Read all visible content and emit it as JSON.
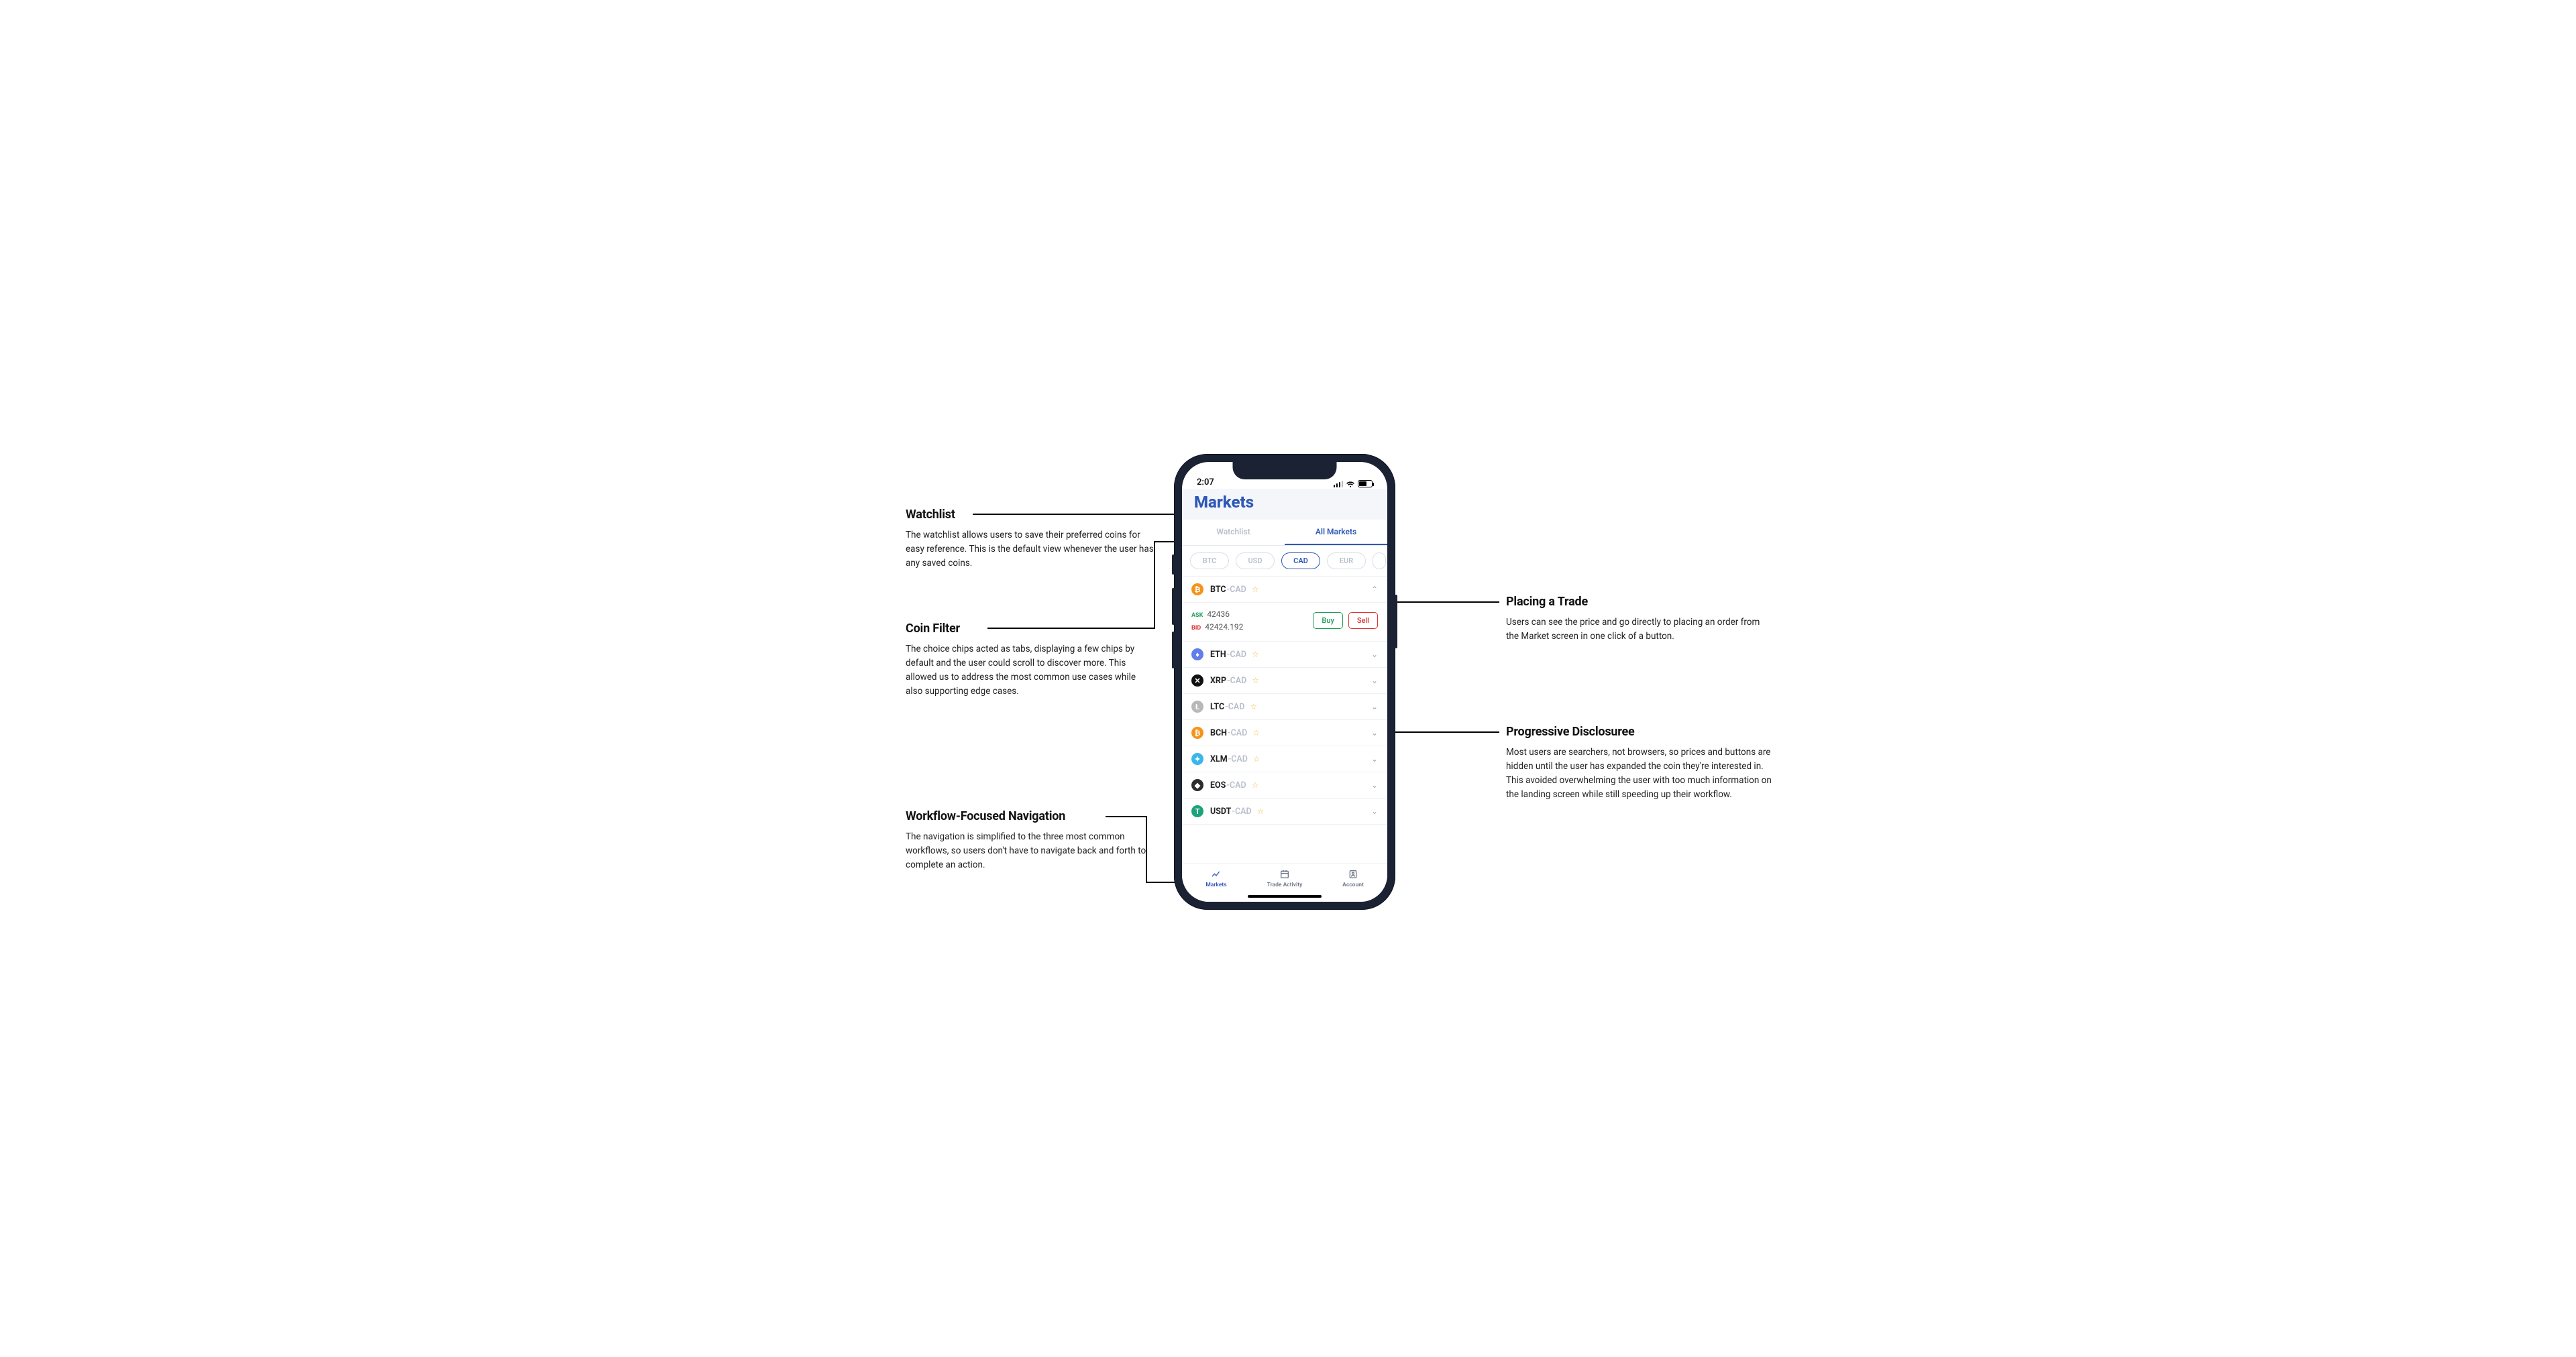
{
  "status": {
    "time": "2:07"
  },
  "app": {
    "title": "Markets"
  },
  "tabs": {
    "watchlist": "Watchlist",
    "all_markets": "All Markets"
  },
  "chips": [
    "BTC",
    "USD",
    "CAD",
    "EUR"
  ],
  "expanded": {
    "ask_label": "ASK",
    "bid_label": "BID",
    "ask_value": "42436",
    "bid_value": "42424.192",
    "buy": "Buy",
    "sell": "Sell"
  },
  "rows": [
    {
      "base": "BTC",
      "quote": "-CAD",
      "color": "#f7931a",
      "glyph": "₿",
      "expanded": true
    },
    {
      "base": "ETH",
      "quote": "-CAD",
      "color": "#627eea",
      "glyph": "♦"
    },
    {
      "base": "XRP",
      "quote": "-CAD",
      "color": "#111111",
      "glyph": "✕"
    },
    {
      "base": "LTC",
      "quote": "-CAD",
      "color": "#b8b8b8",
      "glyph": "Ł"
    },
    {
      "base": "BCH",
      "quote": "-CAD",
      "color": "#f7931a",
      "glyph": "₿"
    },
    {
      "base": "XLM",
      "quote": "-CAD",
      "color": "#3ab7e8",
      "glyph": "✦"
    },
    {
      "base": "EOS",
      "quote": "-CAD",
      "color": "#2c2c2c",
      "glyph": "◆"
    },
    {
      "base": "USDT",
      "quote": "-CAD",
      "color": "#1aa37a",
      "glyph": "T"
    }
  ],
  "nav": {
    "markets": "Markets",
    "trade": "Trade Activity",
    "account": "Account"
  },
  "annotations": {
    "watchlist": {
      "title": "Watchlist",
      "body": "The watchlist allows users to save their preferred coins for easy reference. This is the default view whenever the user has any saved coins."
    },
    "coin_filter": {
      "title": "Coin Filter",
      "body": "The choice chips acted as tabs, displaying a few chips by default and the user could scroll to discover more. This allowed us to address the most common use cases while also supporting edge cases."
    },
    "workflow_nav": {
      "title": "Workflow-Focused Navigation",
      "body": "The navigation is simplified to the three most common workflows, so users don't have to navigate back and forth to complete an action."
    },
    "placing_trade": {
      "title": "Placing a Trade",
      "body": "Users can see the price and go directly to placing an order from the Market screen in one click of a button."
    },
    "progressive": {
      "title": "Progressive Disclosuree",
      "body": "Most users are searchers, not browsers, so prices and buttons are hidden until the user has expanded the coin they're interested in. This avoided overwhelming the user with too much information on the landing screen while still speeding up their workflow."
    }
  }
}
